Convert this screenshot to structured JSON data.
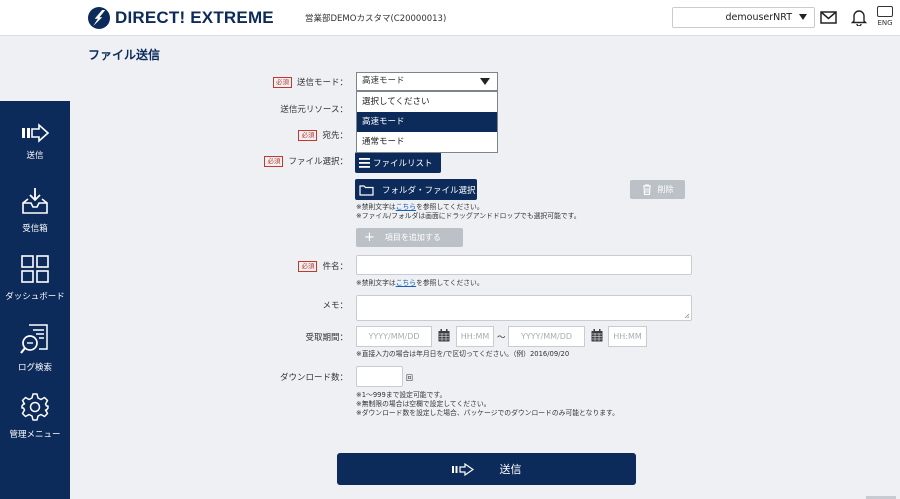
{
  "header": {
    "logo_text": "DIRECT! EXTREME",
    "company": "営業部DEMOカスタマ(C20000013)",
    "user": "demouserNRT",
    "lang": "ENG"
  },
  "icons": {
    "logo": "lightning-bolt-logo",
    "mail": "mail-icon",
    "bell": "bell-icon",
    "lang": "language-icon",
    "send": "send-arrow-icon",
    "inbox": "inbox-tray-icon",
    "dashboard": "grid-icon",
    "log": "log-search-icon",
    "admin": "gear-icon",
    "filelist": "hamburger-icon",
    "folder": "folder-icon",
    "trash": "trash-icon",
    "plus": "plus-icon",
    "calendar": "calendar-icon"
  },
  "sidebar": {
    "items": [
      {
        "label": "送信"
      },
      {
        "label": "受信箱"
      },
      {
        "label": "ダッシュボード"
      },
      {
        "label": "ログ検索"
      },
      {
        "label": "管理メニュー"
      }
    ]
  },
  "page": {
    "title": "ファイル送信"
  },
  "form": {
    "required_badge": "必須",
    "mode": {
      "label": "送信モード：",
      "value": "高速モード",
      "options": [
        "選択してください",
        "高速モード",
        "通常モード"
      ]
    },
    "resource": {
      "label": "送信元リソース："
    },
    "to": {
      "label": "宛先："
    },
    "file": {
      "label": "ファイル選択：",
      "list_button": "ファイルリスト",
      "folder_button": "フォルダ・ファイル選択",
      "delete_button": "削除",
      "note1_pre": "※禁則文字は",
      "note1_link": "こちら",
      "note1_post": "を参照してください。",
      "note2": "※ファイル/フォルダは画面にドラッグアンドドロップでも選択可能です。",
      "add_button": "項目を追加する"
    },
    "subject": {
      "label": "件名：",
      "value": "",
      "note_pre": "※禁則文字は",
      "note_link": "こちら",
      "note_post": "を参照してください。"
    },
    "memo": {
      "label": "メモ：",
      "value": ""
    },
    "period": {
      "label": "受取期間：",
      "date_placeholder": "YYYY/MM/DD",
      "time_placeholder": "HH:MM",
      "separator": "～",
      "note": "※直接入力の場合は年月日を/で区切ってください。（例）2016/09/20"
    },
    "downloads": {
      "label": "ダウンロード数：",
      "value": "",
      "unit": "回",
      "note1": "※1～999まで設定可能です。",
      "note2": "※無制限の場合は空欄で設定してください。",
      "note3": "※ダウンロード数を設定した場合、パッケージでのダウンロードのみ可能となります。"
    },
    "submit": "送信"
  }
}
